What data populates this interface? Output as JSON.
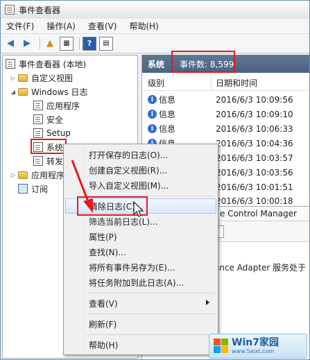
{
  "window": {
    "title": "事件查看器"
  },
  "menu": [
    "文件(F)",
    "操作(A)",
    "查看(V)",
    "帮助(H)"
  ],
  "tree": {
    "root": "事件查看器 (本地)",
    "custom_views": "自定义视图",
    "windows_logs": "Windows 日志",
    "logs": [
      "应用程序",
      "安全",
      "Setup",
      "系统",
      "转发"
    ],
    "app_services": "应用程序",
    "subscriptions": "订阅"
  },
  "panel": {
    "title": "系统",
    "count": "事件数: 8,599",
    "col_level": "级别",
    "col_datetime": "日期和时间",
    "events": [
      {
        "level": "信息",
        "datetime": "2016/6/3 10:09:56"
      },
      {
        "level": "信息",
        "datetime": "2016/6/3 10:09:10"
      },
      {
        "level": "信息",
        "datetime": "2016/6/3 10:06:33"
      },
      {
        "level": "信息",
        "datetime": "2016/6/3 10:04:36"
      },
      {
        "level": "信息",
        "datetime": "2016/6/3 10:03:57"
      },
      {
        "level": "信息",
        "datetime": "2016/6/3 10:03:56"
      },
      {
        "level": "信息",
        "datetime": "2016/6/3 10:01:51"
      },
      {
        "level": "信息",
        "datetime": "2016/6/3 10:00:18"
      }
    ],
    "detail_source": "e Control Manager",
    "detail_text": "ance Adapter 服务处于"
  },
  "context_menu": {
    "open_saved": "打开保存的日志(O)...",
    "create_view": "创建自定义视图(R)...",
    "import_view": "导入自定义视图(M)...",
    "clear_log": "清除日志(C)...",
    "filter_log": "筛选当前日志(L)...",
    "properties": "属性(P)",
    "find": "查找(N)...",
    "save_all": "将所有事件另存为(E)...",
    "attach_task": "将任务附加到此日志(A)...",
    "view": "查看(V)",
    "refresh": "刷新(F)",
    "help": "帮助(H)"
  },
  "watermark": {
    "title": "Win7家园",
    "url": "www.5aixt.com"
  },
  "colors": {
    "highlight": "#e5191f",
    "header_bg": "#556d8d",
    "info_blue": "#2f6fd1"
  }
}
